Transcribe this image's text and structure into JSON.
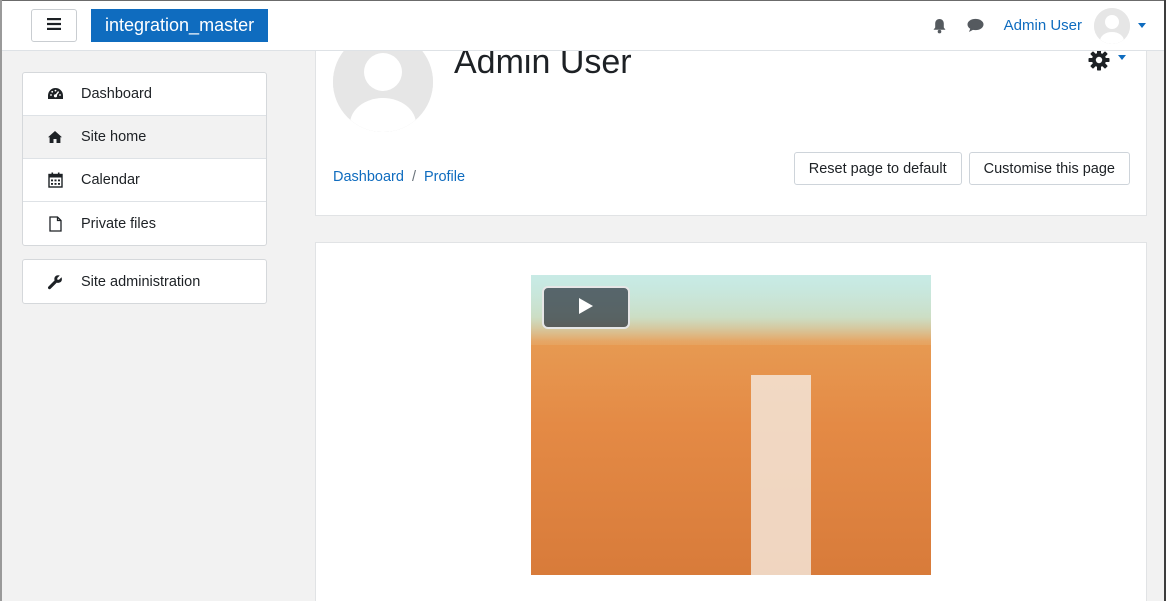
{
  "navbar": {
    "menu_icon": "hamburger-icon",
    "brand": "integration_master",
    "notifications_icon": "bell-icon",
    "messages_icon": "chat-bubble-icon",
    "user_name": "Admin User",
    "user_menu_icon": "caret-down-icon"
  },
  "sidebar": {
    "items": [
      {
        "label": "Dashboard",
        "icon": "dashboard-icon"
      },
      {
        "label": "Site home",
        "icon": "home-icon",
        "active": true
      },
      {
        "label": "Calendar",
        "icon": "calendar-icon"
      },
      {
        "label": "Private files",
        "icon": "file-icon"
      }
    ],
    "admin_item": {
      "label": "Site administration",
      "icon": "wrench-icon"
    }
  },
  "header": {
    "title": "Admin User",
    "settings_icon": "gear-icon",
    "breadcrumb": [
      {
        "label": "Dashboard"
      },
      {
        "label": "Profile"
      }
    ],
    "breadcrumb_separator": "/",
    "reset_button": "Reset page to default",
    "customise_button": "Customise this page"
  },
  "content": {
    "media": "video-player",
    "play_icon": "play-icon"
  },
  "colors": {
    "brand": "#0f6cbf",
    "link": "#0f6cbf",
    "background": "#f2f2f2"
  }
}
